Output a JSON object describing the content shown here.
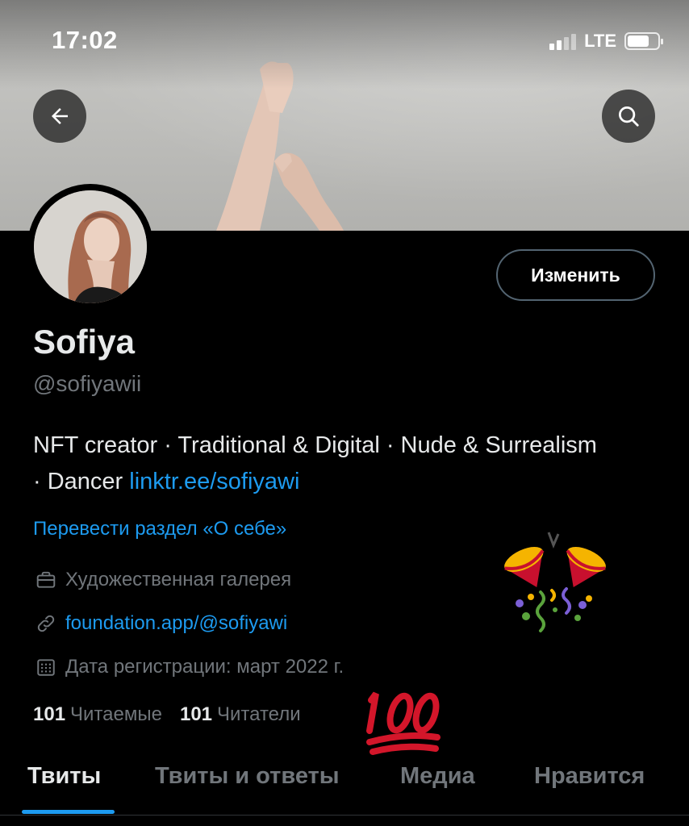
{
  "status_bar": {
    "time": "17:02",
    "network": "LTE"
  },
  "header": {
    "back_icon": "arrow-left-icon",
    "search_icon": "search-icon"
  },
  "profile": {
    "edit_label": "Изменить",
    "name": "Sofiya",
    "handle": "@sofiyawii",
    "bio_text": "NFT creator · Traditional & Digital · Nude & Surrealism · Dancer ",
    "bio_link": "linktr.ee/sofiyawi",
    "translate_label": "Перевести раздел «О себе»",
    "category": "Художественная галерея",
    "website": "foundation.app/@sofiyawi",
    "joined": "Дата регистрации: март 2022 г.",
    "following_count": "101",
    "following_label": "Читаемые",
    "followers_count": "101",
    "followers_label": "Читатели"
  },
  "tabs": [
    {
      "label": "Твиты",
      "active": true
    },
    {
      "label": "Твиты и ответы",
      "active": false
    },
    {
      "label": "Медиа",
      "active": false
    },
    {
      "label": "Нравится",
      "active": false
    }
  ],
  "colors": {
    "accent": "#1d9bf0",
    "background": "#000000",
    "secondary_text": "#71767b"
  },
  "emoji": [
    "party-popper",
    "hundred-points"
  ]
}
